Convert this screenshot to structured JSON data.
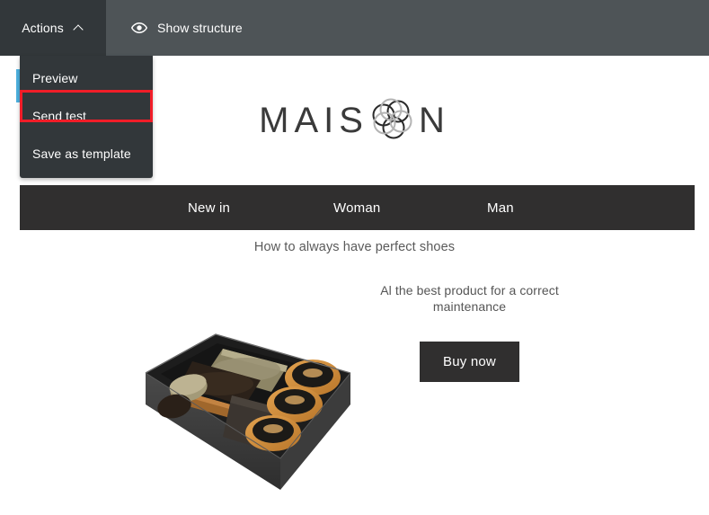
{
  "toolbar": {
    "actions_button": {
      "label": "Actions",
      "icon": "chevron-up-icon",
      "expanded": true
    },
    "show_structure": {
      "label": "Show structure",
      "icon": "eye-icon"
    },
    "background_color": "#4e5457",
    "actions_background_color": "#32373a"
  },
  "dropdown": {
    "items": [
      {
        "label": "Preview",
        "highlighted": false
      },
      {
        "label": "Send test",
        "highlighted": true
      },
      {
        "label": "Save as template",
        "highlighted": false
      }
    ],
    "background_color": "#32373a",
    "highlight_border_color": "#f11d28"
  },
  "accent": {
    "blue_bar_color": "#4db2e0"
  },
  "email": {
    "logo": {
      "text_left": "MAIS",
      "text_right": "N",
      "full_text": "MAISON",
      "icon": "flower-circles-logo",
      "color": "#3a3a3a"
    },
    "nav": {
      "background_color": "#302f2f",
      "items": [
        {
          "label": "New in"
        },
        {
          "label": "Woman"
        },
        {
          "label": "Man"
        }
      ]
    },
    "headline": "How to always have perfect shoes",
    "product": {
      "description": "Al the best product for a correct maintenance",
      "cta_label": "Buy now",
      "cta_background_color": "#302f2f",
      "image_alt": "shoe-care-kit-box"
    }
  }
}
